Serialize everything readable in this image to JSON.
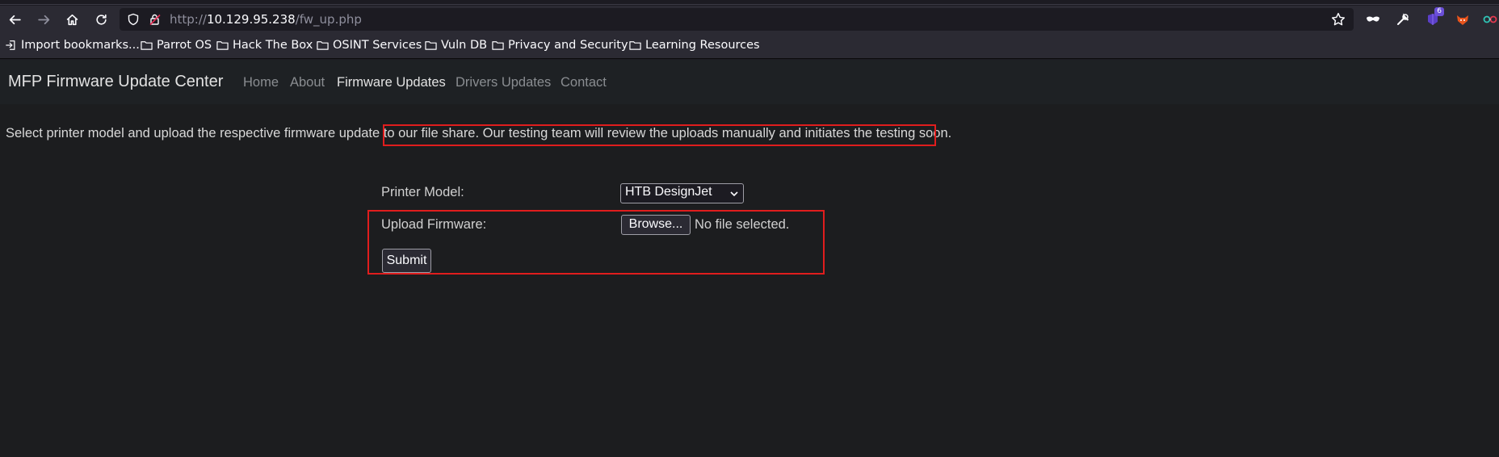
{
  "browser": {
    "url_prefix": "http://",
    "url_host": "10.129.95.238",
    "url_path": "/fw_up.php",
    "nav_icons": [
      "back-arrow-icon",
      "forward-arrow-icon",
      "home-icon",
      "reload-icon"
    ],
    "extension_badge": "6"
  },
  "bookmarks": [
    {
      "label": "Import bookmarks...",
      "icon": "import-icon"
    },
    {
      "label": "Parrot OS",
      "icon": "folder-icon"
    },
    {
      "label": "Hack The Box",
      "icon": "folder-icon"
    },
    {
      "label": "OSINT Services",
      "icon": "folder-icon"
    },
    {
      "label": "Vuln DB",
      "icon": "folder-icon"
    },
    {
      "label": "Privacy and Security",
      "icon": "folder-icon"
    },
    {
      "label": "Learning Resources",
      "icon": "folder-icon"
    }
  ],
  "site": {
    "brand": "MFP Firmware Update Center",
    "menu": [
      "Home",
      "About",
      "Firmware Updates",
      "Drivers Updates",
      "Contact"
    ],
    "active_menu": "Firmware Updates"
  },
  "main": {
    "intro": "Select printer model and upload the respective firmware update to our file share. Our testing team will review the uploads manually and initiates the testing soon.",
    "printer_model_label": "Printer Model:",
    "printer_model_value": "HTB DesignJet",
    "upload_label": "Upload Firmware:",
    "browse_label": "Browse...",
    "file_status": "No file selected.",
    "submit_label": "Submit"
  },
  "colors": {
    "highlight": "#e01d1d",
    "page_bg": "#1c1d1f",
    "browser_bg": "#2b2a33"
  }
}
